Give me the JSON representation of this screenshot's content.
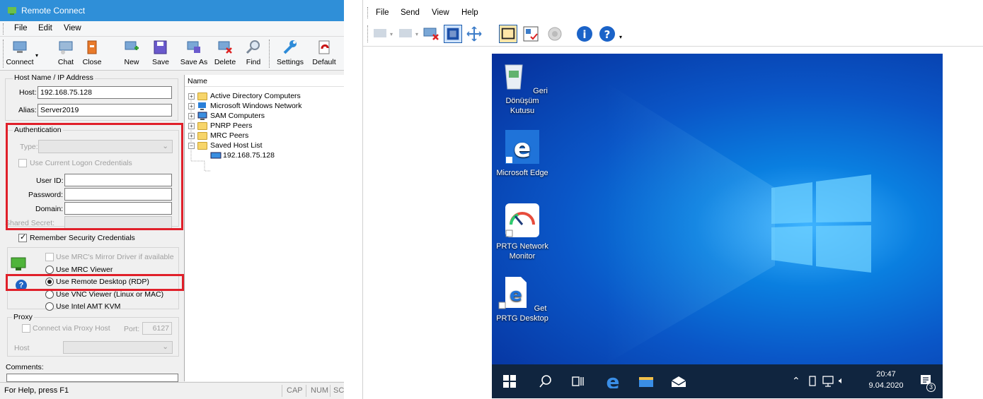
{
  "left_window": {
    "title": "Remote Connect",
    "menu": [
      "File",
      "Edit",
      "View"
    ],
    "toolbar": {
      "connect": "Connect",
      "chat": "Chat",
      "close": "Close",
      "new": "New",
      "save": "Save",
      "save_as": "Save As",
      "delete": "Delete",
      "find": "Find",
      "settings": "Settings",
      "default": "Default"
    },
    "host_group": {
      "title": "Host Name / IP Address",
      "host_label": "Host:",
      "host_value": "192.168.75.128",
      "alias_label": "Alias:",
      "alias_value": "Server2019"
    },
    "auth_group": {
      "title": "Authentication",
      "type_label": "Type:",
      "use_current": "Use Current Logon Credentials",
      "userid_label": "User ID:",
      "password_label": "Password:",
      "domain_label": "Domain:",
      "shared_secret_label": "Shared Secret:"
    },
    "remember": "Remember Security Credentials",
    "viewer": {
      "mirror": "Use MRC's Mirror Driver if available",
      "mrc": "Use MRC Viewer",
      "rdp": "Use Remote Desktop (RDP)",
      "vnc": "Use VNC Viewer (Linux or MAC)",
      "amt": "Use Intel AMT KVM"
    },
    "proxy": {
      "title": "Proxy",
      "connect_via": "Connect via Proxy Host",
      "port_label": "Port:",
      "port_value": "6127",
      "host_label": "Host"
    },
    "comments_label": "Comments:",
    "tree": {
      "header": "Name",
      "items": [
        "Active Directory Computers",
        "Microsoft Windows Network",
        "SAM Computers",
        "PNRP Peers",
        "MRC Peers",
        "Saved Host List"
      ],
      "child": "192.168.75.128"
    },
    "status": {
      "help": "For Help, press F1",
      "cap": "CAP",
      "num": "NUM",
      "scr": "SCI"
    }
  },
  "right_window": {
    "menu": [
      "File",
      "Send",
      "View",
      "Help"
    ],
    "desktop_icons": [
      {
        "label": "Geri Dönüşüm Kutusu"
      },
      {
        "label": "Microsoft Edge"
      },
      {
        "label": "PRTG Network Monitor"
      },
      {
        "label": "Get PRTG Desktop"
      }
    ],
    "clock_time": "20:47",
    "clock_date": "9.04.2020",
    "notification_count": "3"
  },
  "colors": {
    "highlight": "#e0202a",
    "titlebar": "#2f8fd8",
    "taskbar": "#10253f"
  }
}
